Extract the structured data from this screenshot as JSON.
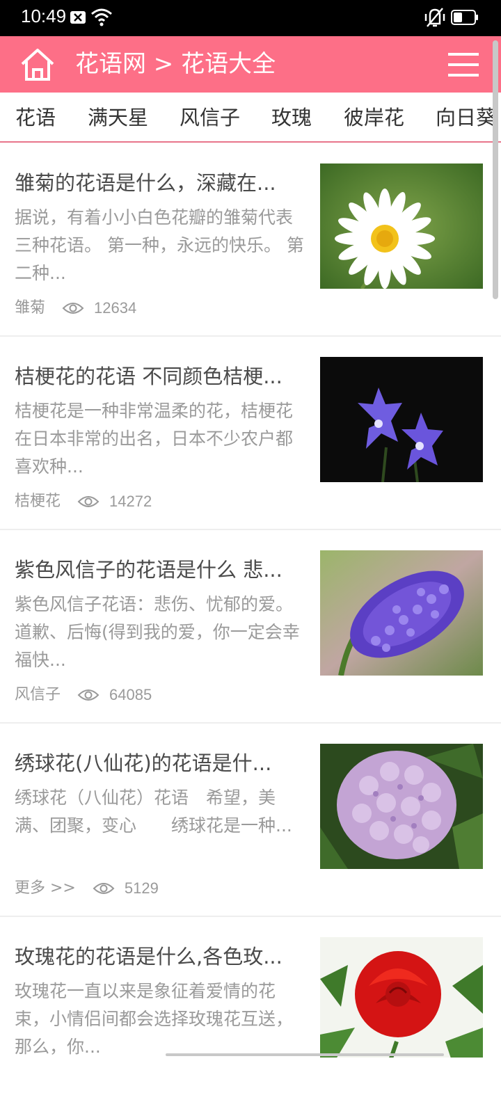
{
  "status_bar": {
    "time": "10:49"
  },
  "header": {
    "title": "花语网 > 花语大全"
  },
  "tabs": [
    "花语",
    "满天星",
    "风信子",
    "玫瑰",
    "彼岸花",
    "向日葵"
  ],
  "articles": [
    {
      "title": "雏菊的花语是什么，深藏在...",
      "summary": "据说，有着小小白色花瓣的雏菊代表三种花语。 第一种，永远的快乐。 第二种...",
      "tag": "雏菊",
      "views": "12634",
      "image": "daisy"
    },
    {
      "title": "桔梗花的花语 不同颜色桔梗...",
      "summary": "桔梗花是一种非常温柔的花，桔梗花在日本非常的出名，日本不少农户都喜欢种...",
      "tag": "桔梗花",
      "views": "14272",
      "image": "balloon-flower"
    },
    {
      "title": "紫色风信子的花语是什么 悲...",
      "summary": "紫色风信子花语：悲伤、忧郁的爱。道歉、后悔(得到我的爱，你一定会幸福快...",
      "tag": "风信子",
      "views": "64085",
      "image": "hyacinth"
    },
    {
      "title": "绣球花(八仙花)的花语是什...",
      "summary": "绣球花（八仙花）花语　希望，美满、团聚，变心　　绣球花是一种...",
      "tag": "更多 >>",
      "views": "5129",
      "image": "hydrangea"
    },
    {
      "title": "玫瑰花的花语是什么,各色玫...",
      "summary": "玫瑰花一直以来是象征着爱情的花束，小情侣间都会选择玫瑰花互送，那么，你...",
      "tag": "",
      "views": "",
      "image": "rose"
    }
  ]
}
